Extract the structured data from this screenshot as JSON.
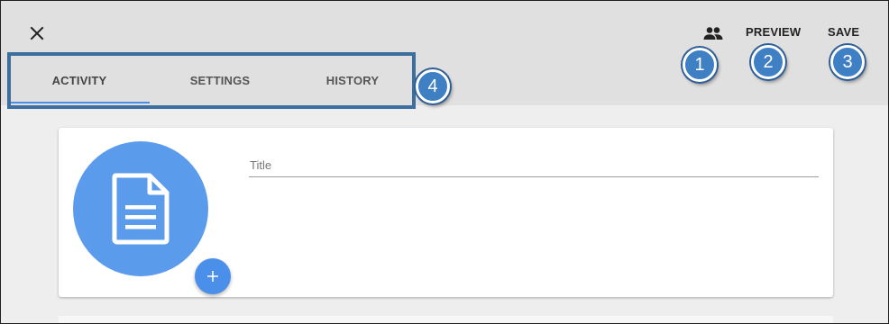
{
  "toolbar": {
    "close_icon": "close-icon",
    "share_icon": "people-icon",
    "preview_label": "PREVIEW",
    "save_label": "SAVE"
  },
  "tabs": [
    {
      "label": "ACTIVITY",
      "active": true
    },
    {
      "label": "SETTINGS",
      "active": false
    },
    {
      "label": "HISTORY",
      "active": false
    }
  ],
  "callouts": [
    "1",
    "2",
    "3",
    "4"
  ],
  "form": {
    "title_placeholder": "Title",
    "title_value": "",
    "doc_icon": "document-icon",
    "add_icon": "plus-icon"
  },
  "colors": {
    "accent": "#4b8ee8",
    "doc_circle": "#5b9bec",
    "callout": "#3f7fc3",
    "highlight_border": "#3c6e9e",
    "topbar": "#e0e0e0"
  }
}
